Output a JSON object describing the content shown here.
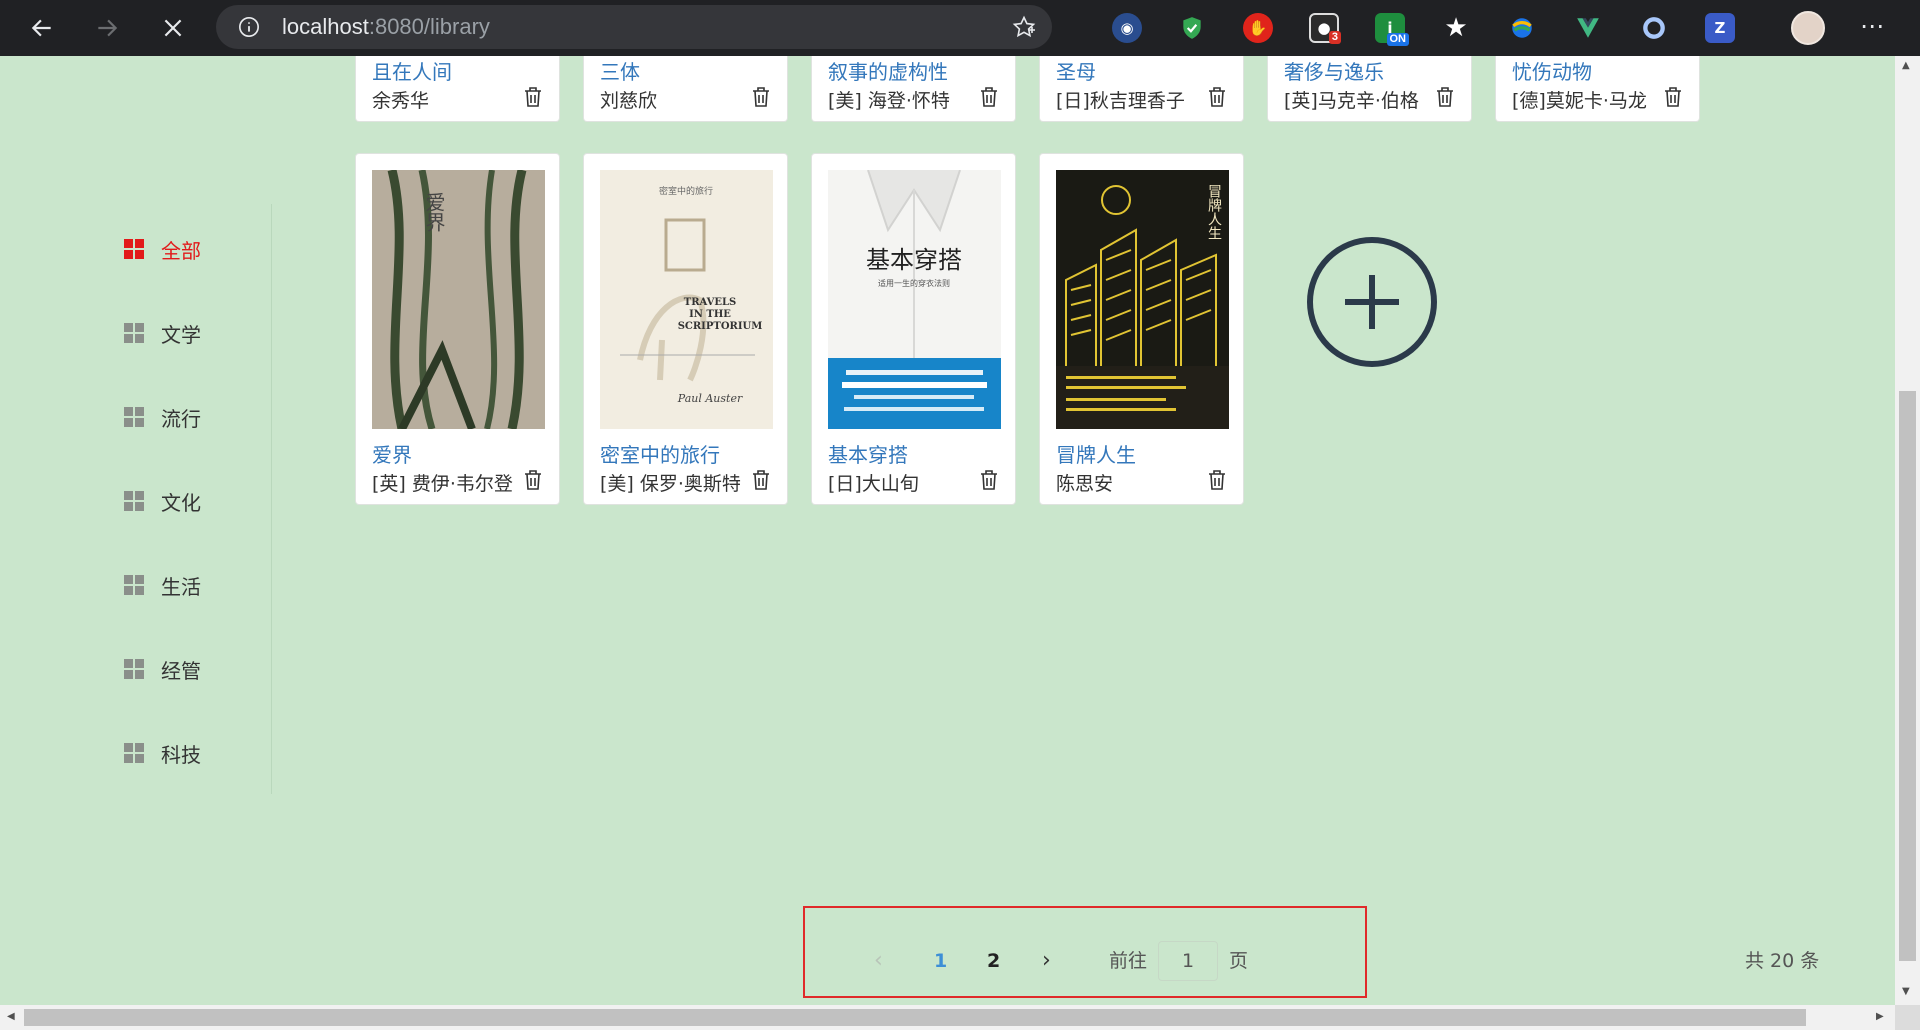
{
  "browser": {
    "url_host": "localhost",
    "url_rest": ":8080/library",
    "extensions": [
      {
        "name": "firefox-relay-icon",
        "bg": "#2a4d8f"
      },
      {
        "name": "shield-check-icon",
        "bg": "#34a853"
      },
      {
        "name": "stop-hand-icon",
        "bg": "#e0241b"
      },
      {
        "name": "recorder-icon",
        "bg": "#3c3c3c",
        "badge": "3"
      },
      {
        "name": "toggle-on-icon",
        "bg": "#1e8e3e",
        "badge": "ON"
      },
      {
        "name": "star-bookmark-icon",
        "bg": "transparent"
      },
      {
        "name": "rainbow-globe-icon",
        "bg": "transparent"
      },
      {
        "name": "vue-devtools-icon",
        "bg": "transparent"
      },
      {
        "name": "loop-icon",
        "bg": "transparent"
      },
      {
        "name": "zotero-icon",
        "bg": "#3a5bc7"
      }
    ]
  },
  "sidebar": {
    "items": [
      {
        "label": "全部",
        "active": true
      },
      {
        "label": "文学"
      },
      {
        "label": "流行"
      },
      {
        "label": "文化"
      },
      {
        "label": "生活"
      },
      {
        "label": "经管"
      },
      {
        "label": "科技"
      }
    ]
  },
  "books_top": [
    {
      "title": "且在人间",
      "author": "余秀华"
    },
    {
      "title": "三体",
      "author": "刘慈欣"
    },
    {
      "title": "叙事的虚构性",
      "author": "[美] 海登·怀特"
    },
    {
      "title": "圣母",
      "author": "[日]秋吉理香子"
    },
    {
      "title": "奢侈与逸乐",
      "author": "[英]马克辛·伯格"
    },
    {
      "title": "忧伤动物",
      "author": "[德]莫妮卡·马龙"
    }
  ],
  "books": [
    {
      "title": "爱界",
      "author": "[英] 费伊·韦尔登",
      "cover_text": "爱界"
    },
    {
      "title": "密室中的旅行",
      "author": "[美] 保罗·奥斯特",
      "cover_text": "TRAVELS IN THE SCRIPTORIUM",
      "cover_subtitle": "密室中的旅行"
    },
    {
      "title": "基本穿搭",
      "author": "[日]大山旬",
      "cover_text": "基本穿搭",
      "cover_subtitle": "适用一生的穿衣法则"
    },
    {
      "title": "冒牌人生",
      "author": "陈思安",
      "cover_text": "冒牌人生"
    }
  ],
  "pagination": {
    "prev": "‹",
    "pages": [
      "1",
      "2"
    ],
    "next": "›",
    "goto_label": "前往",
    "goto_value": "1",
    "goto_unit": "页",
    "total": "共 20 条"
  }
}
